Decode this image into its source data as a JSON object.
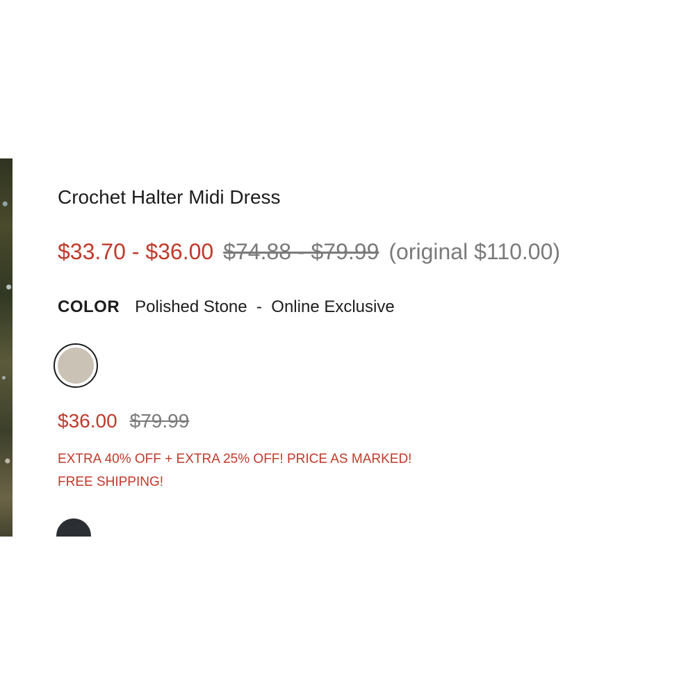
{
  "product": {
    "title": "Crochet Halter Midi Dress",
    "price_range": {
      "sale": "$33.70 - $36.00",
      "was": "$74.88 - $79.99",
      "original": "(original $110.00)"
    },
    "color": {
      "label": "COLOR",
      "selected_name": "Polished Stone  -  Online Exclusive"
    },
    "swatches": [
      {
        "name": "Polished Stone",
        "hex": "#c9c2b5",
        "selected": true
      },
      {
        "name": "",
        "hex": "#2b2e33",
        "selected": false
      }
    ],
    "variant_price": {
      "sale": "$36.00",
      "was": "$79.99"
    },
    "promo_lines": [
      "EXTRA 40% OFF + EXTRA 25% OFF! PRICE AS MARKED!",
      "FREE SHIPPING!"
    ]
  },
  "colors": {
    "sale_red": "#c0392b",
    "muted_gray": "#7a7a7a",
    "text_dark": "#1c1c1c"
  }
}
